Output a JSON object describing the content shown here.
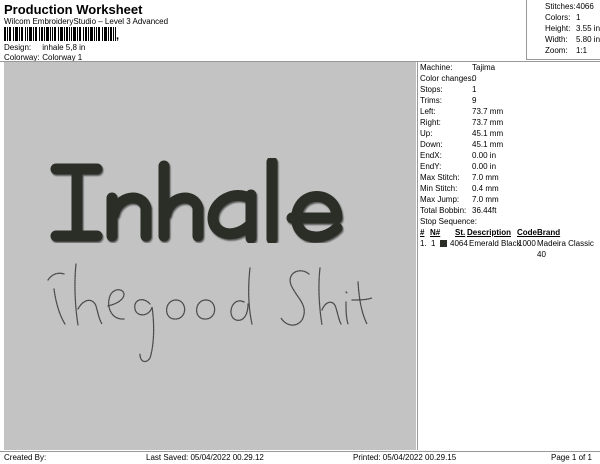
{
  "header": {
    "title": "Production Worksheet",
    "subtitle": "Wilcom EmbroideryStudio – Level 3 Advanced",
    "barcode_suffix": ","
  },
  "design_info": [
    {
      "label": "Design:",
      "value": "inhale 5,8 in"
    },
    {
      "label": "Colorway:",
      "value": "Colorway 1"
    }
  ],
  "stats": [
    {
      "label": "Stitches:",
      "value": "4066"
    },
    {
      "label": "Colors:",
      "value": "1"
    },
    {
      "label": "Height:",
      "value": "3.55 in"
    },
    {
      "label": "Width:",
      "value": "5.80 in"
    },
    {
      "label": "Zoom:",
      "value": "1:1"
    }
  ],
  "specs": [
    {
      "label": "Machine:",
      "value": "Tajima"
    },
    {
      "label": "Color changes:",
      "value": "0"
    },
    {
      "label": "Stops:",
      "value": "1"
    },
    {
      "label": "Trims:",
      "value": "9"
    },
    {
      "label": "Left:",
      "value": "73.7 mm"
    },
    {
      "label": "Right:",
      "value": "73.7 mm"
    },
    {
      "label": "Up:",
      "value": "45.1 mm"
    },
    {
      "label": "Down:",
      "value": "45.1 mm"
    },
    {
      "label": "EndX:",
      "value": "0.00 in"
    },
    {
      "label": "EndY:",
      "value": "0.00 in"
    },
    {
      "label": "Max Stitch:",
      "value": "7.0 mm"
    },
    {
      "label": "Min Stitch:",
      "value": "0.4 mm"
    },
    {
      "label": "Max Jump:",
      "value": "7.0 mm"
    },
    {
      "label": "Total Bobbin:",
      "value": "36.44ft"
    }
  ],
  "stop_sequence": {
    "title": "Stop Sequence:",
    "headers": {
      "n": "#",
      "num": "N#",
      "st": "St.",
      "description": "Description",
      "code": "Code",
      "brand": "Brand"
    },
    "rows": [
      {
        "n": "1.",
        "num": "1",
        "st": "4064",
        "description": "Emerald Black",
        "code": "1000",
        "brand": "Madeira Classic 40",
        "color": "#2b2d27"
      }
    ]
  },
  "design": {
    "line1": "Inhale",
    "line2": "the good Shit",
    "fill_color": "#2b2d27",
    "background_color": "#c3c3c3"
  },
  "footer": {
    "created_by": "Created By:",
    "last_saved": "Last Saved: 05/04/2022 00.29.12",
    "printed": "Printed: 05/04/2022 00.29.15",
    "page": "Page 1 of 1"
  }
}
